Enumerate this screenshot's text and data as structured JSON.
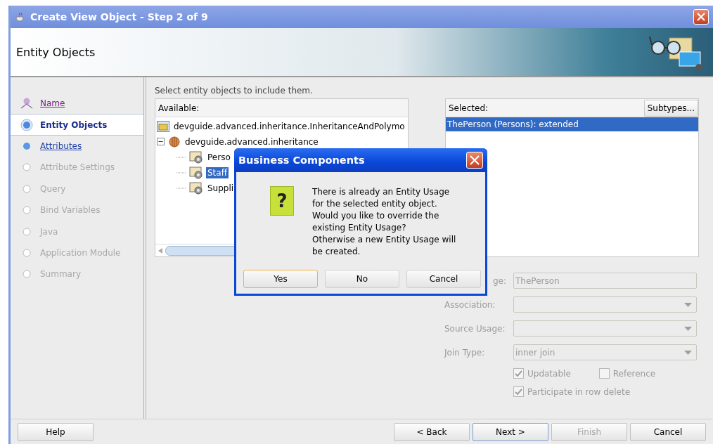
{
  "window": {
    "title": "Create View Object - Step 2 of 9"
  },
  "header": {
    "title": "Entity Objects"
  },
  "steps": [
    {
      "label": "Name",
      "visited": true,
      "selected": false,
      "disabled": false
    },
    {
      "label": "Entity Objects",
      "visited": false,
      "selected": true,
      "disabled": false
    },
    {
      "label": "Attributes",
      "visited": false,
      "selected": false,
      "disabled": false
    },
    {
      "label": "Attribute Settings",
      "visited": false,
      "selected": false,
      "disabled": true
    },
    {
      "label": "Query",
      "visited": false,
      "selected": false,
      "disabled": true
    },
    {
      "label": "Bind Variables",
      "visited": false,
      "selected": false,
      "disabled": true
    },
    {
      "label": "Java",
      "visited": false,
      "selected": false,
      "disabled": true
    },
    {
      "label": "Application Module",
      "visited": false,
      "selected": false,
      "disabled": true
    },
    {
      "label": "Summary",
      "visited": false,
      "selected": false,
      "disabled": true
    }
  ],
  "instruction": "Select entity objects to include them.",
  "available": {
    "label": "Available:",
    "items": [
      {
        "label": "devguide.advanced.inheritance.InheritanceAndPolymo",
        "kind": "project",
        "selected": false
      },
      {
        "label": "devguide.advanced.inheritance",
        "kind": "package",
        "selected": false,
        "expanded": true,
        "children": [
          {
            "label": "Perso",
            "kind": "entity",
            "selected": false
          },
          {
            "label": "Staff",
            "kind": "entity",
            "selected": true
          },
          {
            "label": "Suppli",
            "kind": "entity",
            "selected": false
          }
        ]
      }
    ]
  },
  "selected_list": {
    "label": "Selected:",
    "button": "Subtypes...",
    "items": [
      {
        "label": "ThePerson (Persons): extended",
        "selected": true
      }
    ]
  },
  "fields": [
    {
      "label": "ge:",
      "kind": "text",
      "value": "ThePerson"
    },
    {
      "label": "Association:",
      "kind": "select"
    },
    {
      "label": "Source Usage:",
      "kind": "select"
    },
    {
      "label": "Join Type:",
      "kind": "select",
      "value": "inner join"
    }
  ],
  "checks": [
    [
      {
        "label": "Updatable",
        "checked": true
      },
      {
        "label": "Reference",
        "checked": false
      }
    ],
    [
      {
        "label": "Participate in row delete",
        "checked": true
      }
    ]
  ],
  "dialog": {
    "title": "Business Components",
    "icon_glyph": "?",
    "message": "There is already an Entity Usage\nfor the selected entity object.\nWould you like to override the\nexisting Entity Usage?\nOtherwise a new Entity Usage will\nbe created.",
    "buttons": [
      {
        "label": "Yes",
        "default": true
      },
      {
        "label": "No",
        "default": false
      },
      {
        "label": "Cancel",
        "default": false
      }
    ]
  },
  "footer": {
    "left": [
      {
        "label": "Help",
        "disabled": false,
        "default": false
      }
    ],
    "right": [
      {
        "label": "< Back",
        "disabled": false,
        "default": false
      },
      {
        "label": "Next >",
        "disabled": false,
        "default": true
      },
      {
        "label": "Finish",
        "disabled": true,
        "default": false
      },
      {
        "label": "Cancel",
        "disabled": false,
        "default": false
      }
    ]
  }
}
